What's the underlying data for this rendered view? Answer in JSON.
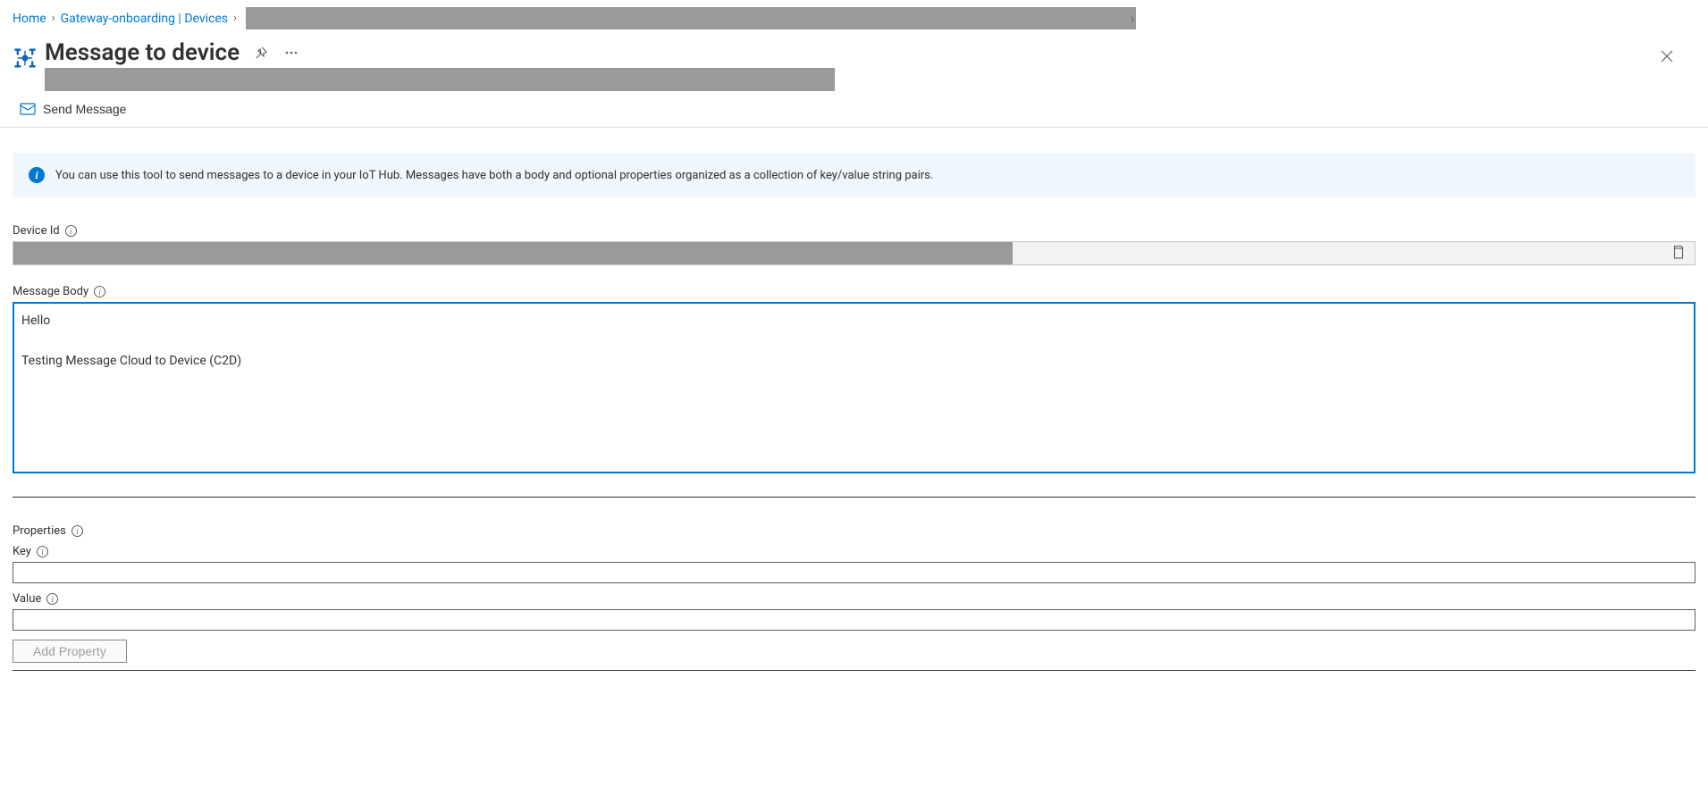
{
  "breadcrumb": {
    "home": "Home",
    "second": "Gateway-onboarding | Devices"
  },
  "header": {
    "title": "Message to device"
  },
  "toolbar": {
    "send_message": "Send Message"
  },
  "info_banner": {
    "text": "You can use this tool to send messages to a device in your IoT Hub. Messages have both a body and optional properties organized as a collection of key/value string pairs."
  },
  "fields": {
    "device_id_label": "Device Id",
    "message_body_label": "Message Body",
    "message_body_value": "Hello\n\nTesting Message Cloud to Device (C2D)",
    "properties_label": "Properties",
    "key_label": "Key",
    "key_value": "",
    "value_label": "Value",
    "value_value": "",
    "add_property_label": "Add Property"
  }
}
